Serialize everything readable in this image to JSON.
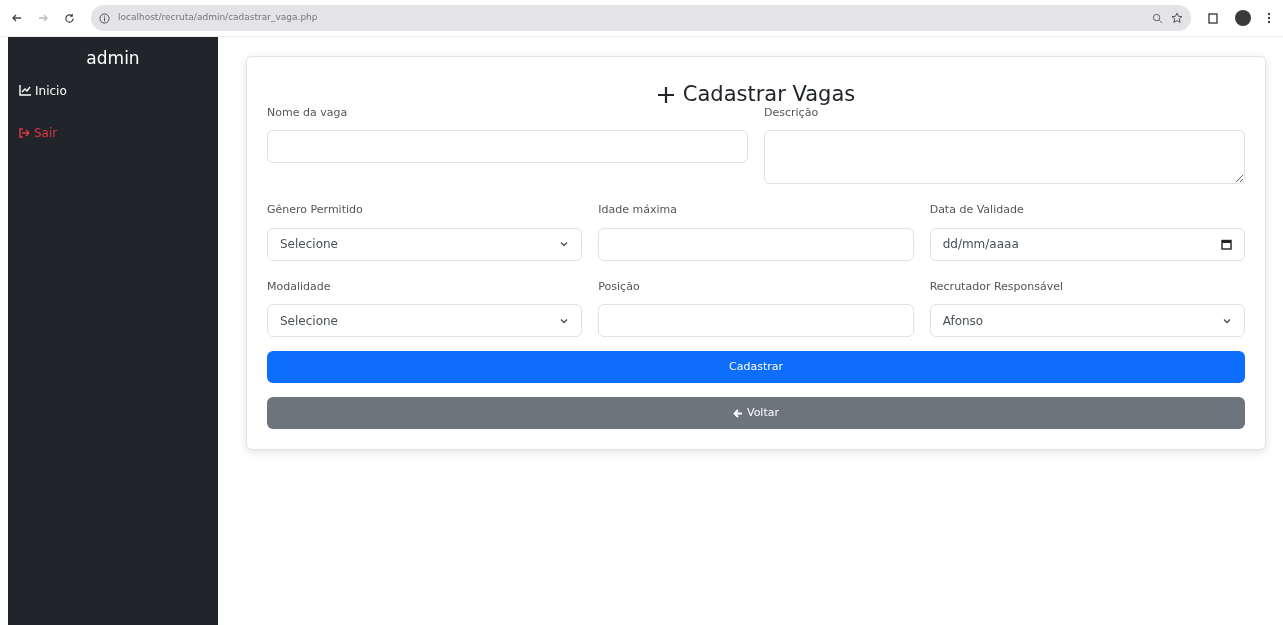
{
  "browser": {
    "url": "localhost/recruta/admin/cadastrar_vaga.php"
  },
  "sidebar": {
    "title": "admin",
    "items": [
      {
        "label": "Inicio",
        "kind": "chart"
      },
      {
        "label": "Sair",
        "kind": "logout"
      }
    ]
  },
  "form": {
    "title": "Cadastrar Vagas",
    "rows": [
      [
        {
          "label": "Nome da vaga",
          "kind": "text"
        },
        {
          "label": "Descrição",
          "kind": "textarea"
        }
      ],
      [
        {
          "label": "Gênero Permitido",
          "kind": "select",
          "value": "Selecione"
        },
        {
          "label": "Idade máxima",
          "kind": "text"
        },
        {
          "label": "Data de Validade",
          "kind": "date",
          "value": "dd/mm/aaaa"
        }
      ],
      [
        {
          "label": "Modalidade",
          "kind": "select",
          "value": "Selecione"
        },
        {
          "label": "Posição",
          "kind": "text"
        },
        {
          "label": "Recrutador Responsável",
          "kind": "select",
          "value": "Afonso"
        }
      ]
    ],
    "buttons": [
      {
        "label": "Cadastrar",
        "kind": "primary"
      },
      {
        "label": "Voltar",
        "kind": "back"
      }
    ]
  }
}
